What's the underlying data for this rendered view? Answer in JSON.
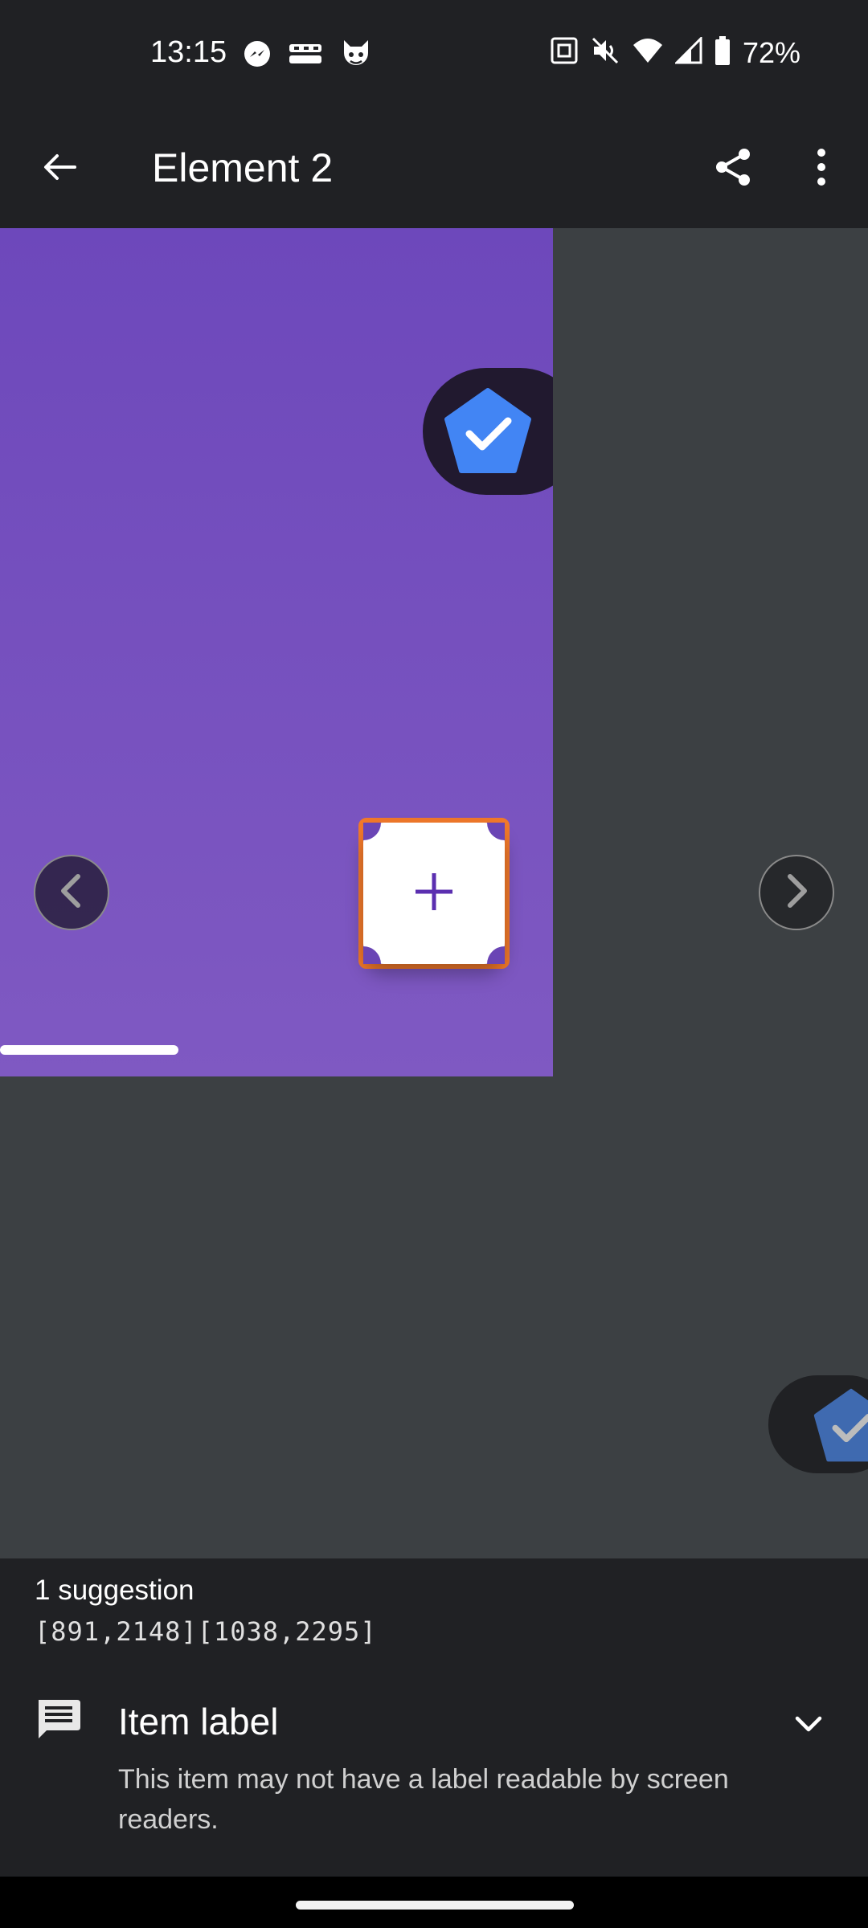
{
  "status_bar": {
    "time": "13:15",
    "left_icons": [
      "messenger-icon",
      "temu-icon",
      "devil-face-icon"
    ],
    "right_icons": [
      "nfc-icon",
      "mute-icon",
      "wifi-icon",
      "signal-icon",
      "battery-icon"
    ],
    "battery_percent": "72%"
  },
  "app_bar": {
    "title": "Element 2",
    "back_icon": "arrow-back-icon",
    "share_icon": "share-icon",
    "more_icon": "more-vert-icon"
  },
  "preview": {
    "background_color": "#7452be",
    "fab_label": "+",
    "fab_accent_color": "#5b2fb0",
    "highlight_color": "#f0782a",
    "badge_color": "#4285f4"
  },
  "bottom_sheet": {
    "suggestion_count": "1 suggestion",
    "bounds": "[891,2148][1038,2295]",
    "item_title": "Item label",
    "item_description": "This item may not have a label readable by screen readers."
  }
}
